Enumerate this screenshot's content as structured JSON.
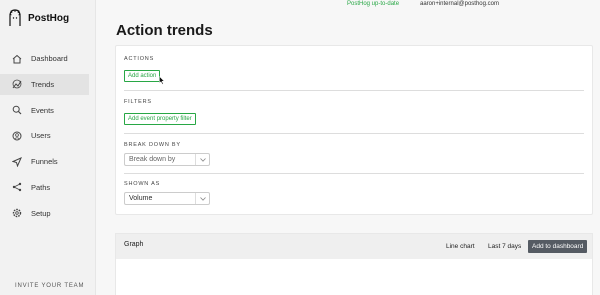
{
  "app": {
    "name": "PostHog",
    "logo_icon": "hedgehog-logo-icon"
  },
  "topbar": {
    "status": "PostHog up-to-date",
    "user_email": "aaron+internal@posthog.com"
  },
  "sidebar": {
    "items": [
      {
        "label": "Dashboard",
        "icon": "home-icon",
        "active": false
      },
      {
        "label": "Trends",
        "icon": "trends-icon",
        "active": true
      },
      {
        "label": "Events",
        "icon": "events-icon",
        "active": false
      },
      {
        "label": "Users",
        "icon": "users-icon",
        "active": false
      },
      {
        "label": "Funnels",
        "icon": "funnels-icon",
        "active": false
      },
      {
        "label": "Paths",
        "icon": "paths-icon",
        "active": false
      },
      {
        "label": "Setup",
        "icon": "setup-icon",
        "active": false
      }
    ],
    "invite": "INVITE YOUR TEAM"
  },
  "page": {
    "title": "Action trends"
  },
  "filters": {
    "actions_label": "ACTIONS",
    "add_action": "Add action",
    "filters_label": "FILTERS",
    "add_property_filter": "Add event property filter",
    "breakdown_label": "BREAK DOWN BY",
    "breakdown_placeholder": "Break down by",
    "shown_as_label": "SHOWN AS",
    "shown_as_value": "Volume"
  },
  "graph": {
    "title": "Graph",
    "chart_type": "Line chart",
    "date_range": "Last 7 days",
    "add_to_dashboard": "Add to dashboard"
  },
  "colors": {
    "accent": "#28a745",
    "dark_button": "#555b63"
  }
}
